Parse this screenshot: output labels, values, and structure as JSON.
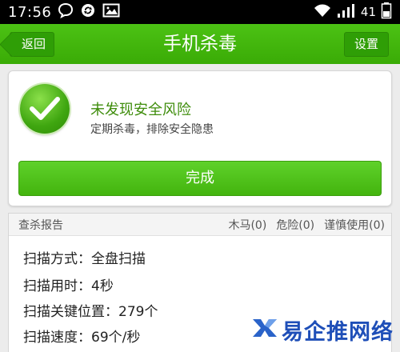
{
  "status_bar": {
    "time": "17:56",
    "battery": "41",
    "icons": [
      "chat-bubble-icon",
      "sync-icon",
      "image-icon",
      "wifi-icon",
      "signal-icon",
      "battery-icon"
    ]
  },
  "app_bar": {
    "title": "手机杀毒",
    "back_label": "返回",
    "settings_label": "设置"
  },
  "result": {
    "title": "未发现安全风险",
    "subtitle": "定期杀毒，排除安全隐患",
    "done_label": "完成"
  },
  "report": {
    "header_title": "查杀报告",
    "counts": {
      "trojan": "木马(0)",
      "danger": "危险(0)",
      "caution": "谨慎使用(0)"
    },
    "lines": [
      "扫描方式：全盘扫描",
      "扫描用时：4秒",
      "扫描关键位置：279个",
      "扫描速度：69个/秒"
    ]
  },
  "watermark": {
    "text": "易企推网络"
  },
  "colors": {
    "accent_green": "#43b40e",
    "app_bar_green": "#3aab06",
    "result_title_green": "#3f8d0c",
    "watermark_blue": "#1f4fb8"
  }
}
